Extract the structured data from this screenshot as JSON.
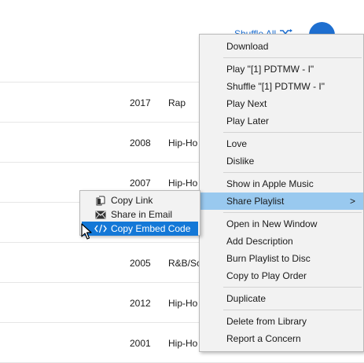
{
  "header": {
    "shuffle_label": "Shuffle All",
    "more_button_icon": "more-icon",
    "shuffle_icon": "shuffle-icon"
  },
  "rows": [
    {
      "year": "2017",
      "genre": "Rap"
    },
    {
      "year": "2008",
      "genre": "Hip-Ho"
    },
    {
      "year": "2007",
      "genre": "Hip-Ho"
    },
    {
      "year": "",
      "genre": ""
    },
    {
      "year": "2005",
      "genre": "R&B/Sc"
    },
    {
      "year": "2012",
      "genre": "Hip-Ho"
    },
    {
      "year": "2001",
      "genre": "Hip-Ho"
    }
  ],
  "context_menu": {
    "items": [
      "Download",
      "Play \"[1] PDTMW - I\"",
      "Shuffle \"[1] PDTMW - I\"",
      "Play Next",
      "Play Later",
      "Love",
      "Dislike",
      "Show in Apple Music",
      "Share Playlist",
      "Open in New Window",
      "Add Description",
      "Burn Playlist to Disc",
      "Copy to Play Order",
      "Duplicate",
      "Delete from Library",
      "Report a Concern"
    ],
    "submenu_arrow": ">"
  },
  "submenu": {
    "items": [
      {
        "label": "Copy Link",
        "icon": "document-icon"
      },
      {
        "label": "Share in Email",
        "icon": "envelope-icon"
      },
      {
        "label": "Copy Embed Code",
        "icon": "code-icon"
      }
    ]
  },
  "colors": {
    "accent": "#1e6fd0",
    "menu_bg": "#f2f2f2",
    "menu_hover": "#99c9ef",
    "submenu_selected": "#1478d7"
  }
}
